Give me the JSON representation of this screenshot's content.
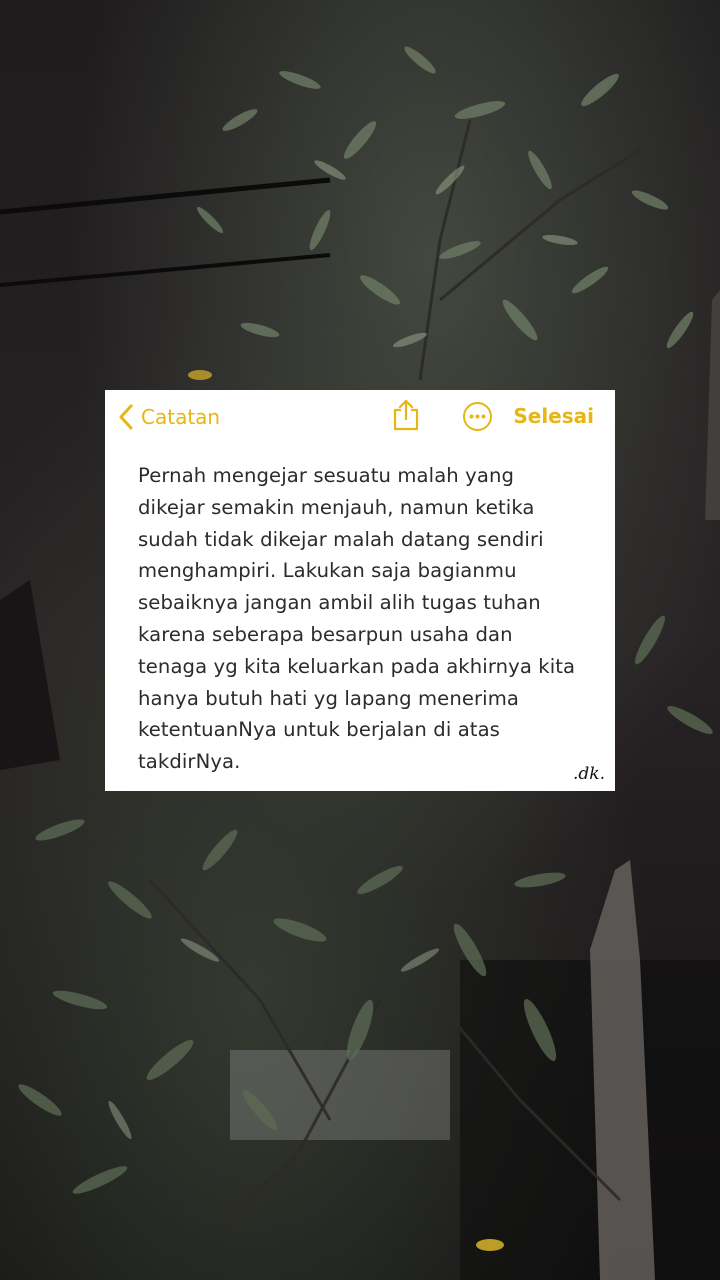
{
  "nav": {
    "back_label": "Catatan",
    "back_icon": "chevron-left-icon",
    "share_icon": "share-icon",
    "more_icon": "ellipsis-circle-icon",
    "done_label": "Selesai"
  },
  "note": {
    "lines": [
      "Pernah mengejar sesuatu malah yang",
      "dikejar semakin menjauh, namun ketika",
      "sudah tidak dikejar malah datang sendiri",
      "menghampiri. Lakukan saja bagianmu",
      "sebaiknya jangan ambil alih tugas tuhan",
      "karena seberapa besarpun usaha dan",
      "tenaga yg kita keluarkan pada akhirnya kita",
      "hanya butuh hati yg lapang menerima",
      "ketentuanNya untuk berjalan di atas",
      "takdirNya."
    ],
    "signature": ".dk."
  },
  "colors": {
    "accent": "#e9b512",
    "card_bg": "#ffffff",
    "text": "#2b2b2b"
  }
}
